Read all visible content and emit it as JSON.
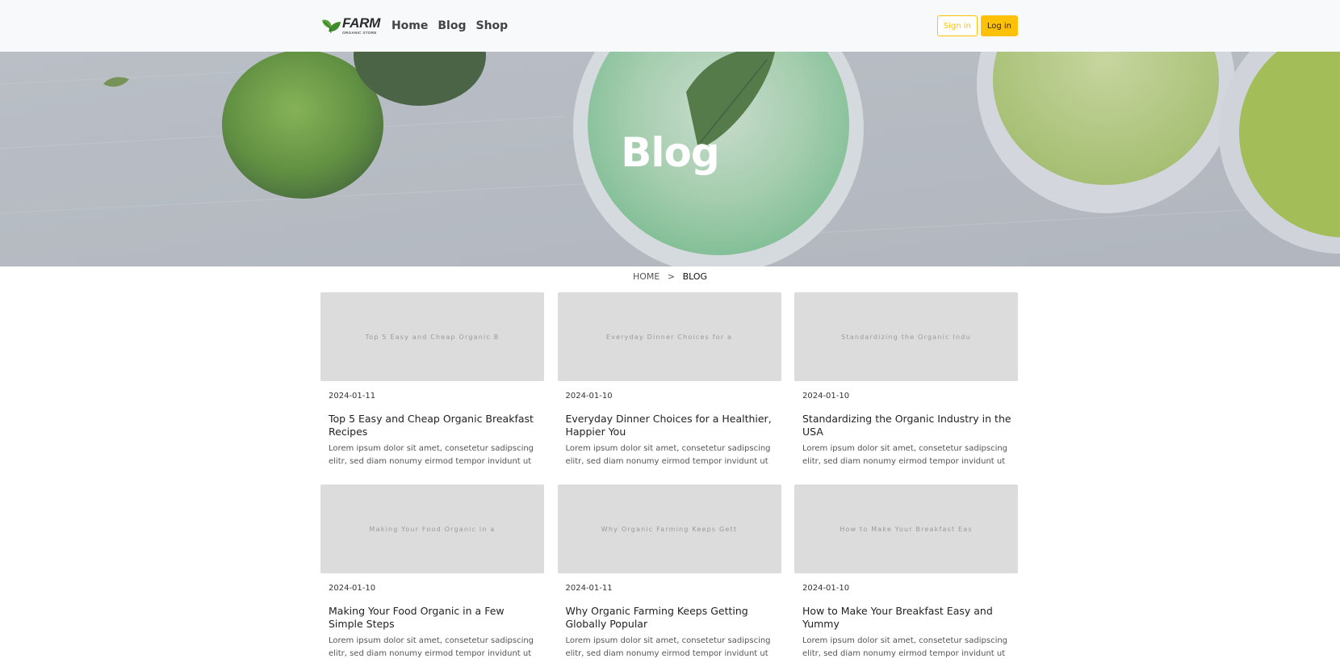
{
  "brand": {
    "name": "FARM",
    "tagline": "ORGANIC STORE"
  },
  "nav": {
    "links": [
      "Home",
      "Blog",
      "Shop"
    ],
    "sign_in": "Sign in",
    "log_in": "Log in"
  },
  "hero": {
    "title": "Blog"
  },
  "breadcrumb": {
    "home": "HOME",
    "separator": ">",
    "current": "BLOG"
  },
  "posts": [
    {
      "thumb_text": "Top 5 Easy and Cheap Organic B",
      "date": "2024-01-11",
      "title": "Top 5 Easy and Cheap Organic Breakfast Recipes",
      "excerpt": "Lorem ipsum dolor sit amet, consetetur sadipscing elitr, sed diam nonumy eirmod tempor invidunt ut l..."
    },
    {
      "thumb_text": "Everyday Dinner Choices for a",
      "date": "2024-01-10",
      "title": "Everyday Dinner Choices for a Healthier, Happier You",
      "excerpt": "Lorem ipsum dolor sit amet, consetetur sadipscing elitr, sed diam nonumy eirmod tempor invidunt ut l..."
    },
    {
      "thumb_text": "Standardizing the Organic Indu",
      "date": "2024-01-10",
      "title": "Standardizing the Organic Industry in the USA",
      "excerpt": "Lorem ipsum dolor sit amet, consetetur sadipscing elitr, sed diam nonumy eirmod tempor invidunt ut l..."
    },
    {
      "thumb_text": "Making Your Food Organic in a",
      "date": "2024-01-10",
      "title": "Making Your Food Organic in a Few Simple Steps",
      "excerpt": "Lorem ipsum dolor sit amet, consetetur sadipscing elitr, sed diam nonumy eirmod tempor invidunt ut l..."
    },
    {
      "thumb_text": "Why Organic Farming Keeps Gett",
      "date": "2024-01-11",
      "title": "Why Organic Farming Keeps Getting Globally Popular",
      "excerpt": "Lorem ipsum dolor sit amet, consetetur sadipscing elitr, sed diam nonumy eirmod tempor invidunt ut l..."
    },
    {
      "thumb_text": "How to Make Your Breakfast Eas",
      "date": "2024-01-10",
      "title": "How to Make Your Breakfast Easy and Yummy",
      "excerpt": "Lorem ipsum dolor sit amet, consetetur sadipscing elitr, sed diam nonumy eirmod tempor invidunt ut l..."
    }
  ],
  "colors": {
    "accent": "#ffc107",
    "navbar_bg": "#f8f9fa",
    "thumb_bg": "#dcdcdc",
    "brand_green": "#5aa33a"
  },
  "icons": {
    "logo": "leaf-icon"
  }
}
